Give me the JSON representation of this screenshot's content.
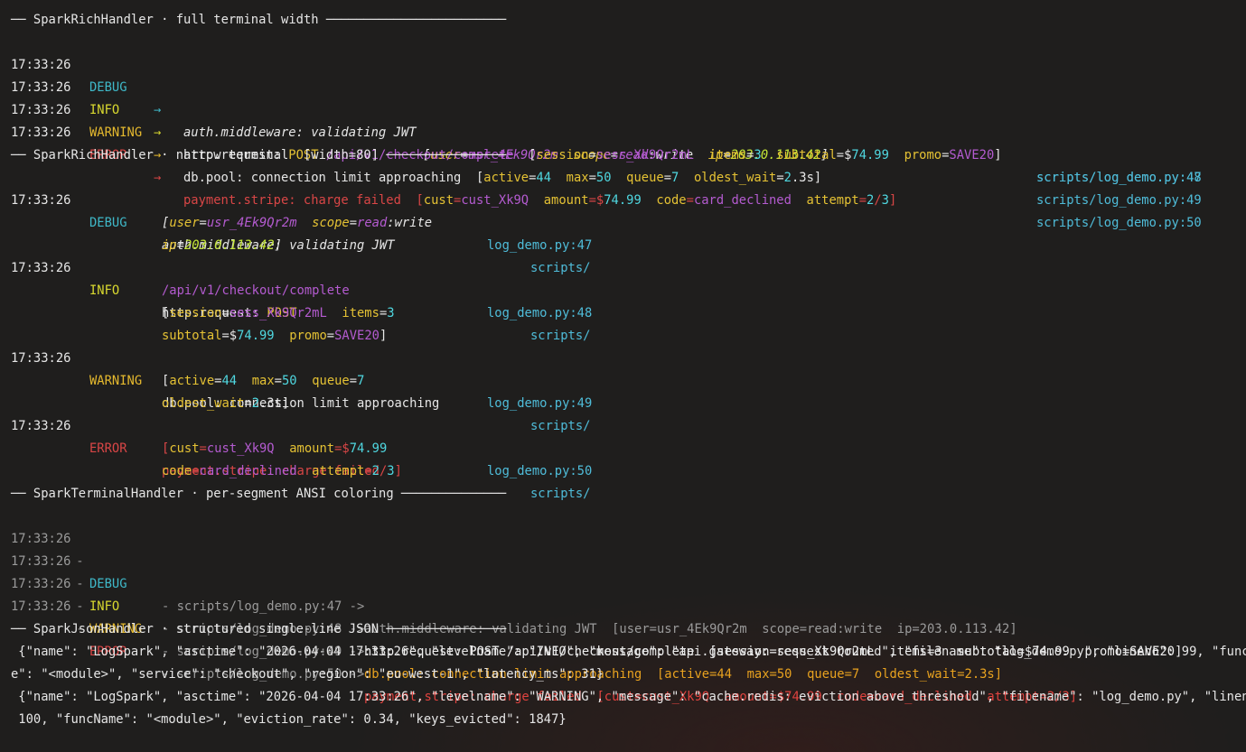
{
  "sections": {
    "full": "── SparkRichHandler · full terminal width ────────────────────────",
    "narrow": "── SparkRichHandler · narrow terminal  [width=80] ────────────────",
    "ansi": "── SparkTerminalHandler · per-segment ANSI coloring ──────────────",
    "json": "── SparkJsonHandler · structured single-line JSON ────────────────"
  },
  "time": "17:33:26",
  "levels": {
    "debug": "DEBUG",
    "info": "INFO",
    "warning": "WARNING",
    "error": "ERROR"
  },
  "arrow": "→",
  "full_rows": {
    "debug": {
      "msg": "auth.middleware: validating JWT",
      "loc": "scripts/log_demo.py:47",
      "ctx": [
        "[",
        "user",
        "=",
        "usr_4Ek9Qr2m",
        "  ",
        "scope",
        "=",
        "read",
        ":write",
        "  ",
        "ip",
        "=",
        "203.",
        "0.113.42",
        "]"
      ]
    },
    "info": {
      "loc": "scripts/log_demo.py:48",
      "logger": "http.request: ",
      "method": "POST ",
      "route": "/api/v1/checkout/complete",
      "ctx": [
        "  [",
        "session",
        "=",
        "sess_Xk9Qr2mL",
        "  ",
        "items",
        "=",
        "3",
        "  ",
        "subtotal",
        "=$",
        "74.99",
        "  ",
        "promo",
        "=",
        "SAVE20",
        "]"
      ]
    },
    "warning": {
      "loc": "scripts/log_demo.py:49",
      "logger": "db.pool: connection limit approaching",
      "ctx": [
        "  [",
        "active",
        "=",
        "44",
        "  ",
        "max",
        "=",
        "50",
        "  ",
        "queue",
        "=",
        "7",
        "  ",
        "oldest_wait",
        "=",
        "2",
        ".3s]"
      ]
    },
    "error": {
      "loc": "scripts/log_demo.py:50",
      "msg": "payment.stripe: charge failed",
      "ctx": [
        "  [",
        "cust",
        "=",
        "cust_Xk9Q",
        "  ",
        "amount",
        "=$",
        "74.99",
        "  ",
        "code",
        "=",
        "card_declined",
        "  ",
        "attempt",
        "=",
        "2",
        "/",
        "3",
        "]"
      ]
    }
  },
  "narrow_rows": {
    "loc_a": "scripts/",
    "debug": {
      "l1": "auth.middleware: validating JWT",
      "l2": [
        "[",
        "user",
        "=",
        "usr_4Ek9Qr2m",
        "  ",
        "scope",
        "=",
        "read",
        ":write"
      ],
      "l3": [
        "ip",
        "=",
        "203.",
        "0.113.42",
        "]"
      ],
      "loc_b": "log_demo.py:47"
    },
    "info": {
      "l1a": "http.request: ",
      "l1b": "POST",
      "l2": "/api/v1/checkout/complete",
      "l3": [
        "[",
        "session",
        "=",
        "sess_Xk9Qr2mL",
        "  ",
        "items",
        "=",
        "3"
      ],
      "l4": [
        "subtotal",
        "=$",
        "74.99",
        "  ",
        "promo",
        "=",
        "SAVE20",
        "]"
      ],
      "loc_b": "log_demo.py:48"
    },
    "warning": {
      "l1": "db.pool: connection limit approaching",
      "l2": [
        "[",
        "active",
        "=",
        "44",
        "  ",
        "max",
        "=",
        "50",
        "  ",
        "queue",
        "=",
        "7"
      ],
      "l3": [
        "oldest_wait",
        "=",
        "2",
        ".3s]"
      ],
      "loc_b": "log_demo.py:49"
    },
    "error": {
      "l1": "payment.stripe: charge failed",
      "l2": [
        "[",
        "cust",
        "=",
        "cust_Xk9Q",
        "  ",
        "amount",
        "=$",
        "74.99"
      ],
      "l3": [
        "code",
        "=",
        "card_declined",
        "  ",
        "attempt",
        "=",
        "2",
        "/",
        "3",
        "]"
      ],
      "loc_b": "log_demo.py:50"
    }
  },
  "ansi_rows": {
    "sep": " - ",
    "debug": {
      "loc": "- scripts/log_demo.py:47 -> ",
      "msg": "auth.middleware: validating JWT  [user=usr_4Ek9Qr2m  scope=read:write  ip=203.0.113.42]"
    },
    "info": {
      "loc": "- scripts/log_demo.py:48 -> ",
      "msg": "http.request: POST /api/v1/checkout/complete  [session=sess_Xk9Qr2mL  items=3  subtotal=$74.99  promo=SAVE20]"
    },
    "warning": {
      "loc": "- scripts/log_demo.py:49 -> ",
      "msg": "db.pool: connection limit approaching  [active=44  max=50  queue=7  oldest_wait=2.3s]"
    },
    "error": {
      "loc": "- scripts/log_demo.py:50 -> ",
      "msg": "payment.stripe: charge failed  [cust=cust_Xk9Q  amount=$74.99  code=card_declined  attempt=2/3]"
    }
  },
  "json_lines": [
    " {\"name\": \"LogSpark\", \"asctime\": \"2026-04-04 17:33:26\", \"levelname\": \"INFO\", \"message\": \"api.gateway: request routed\", \"filename\": \"log_demo.py\", \"lineno\": 99, \"funcNam",
    "e\": \"<module>\", \"service\": \"checkout\", \"region\": \"eu-west-1\", \"latency_ms\": 31}",
    " {\"name\": \"LogSpark\", \"asctime\": \"2026-04-04 17:33:26\", \"levelname\": \"WARNING\", \"message\": \"cache.redis: eviction above threshold\", \"filename\": \"log_demo.py\", \"lineno\":",
    " 100, \"funcName\": \"<module>\", \"eviction_rate\": 0.34, \"keys_evicted\": 1847}"
  ],
  "colors": {
    "background": "#1f1e1d",
    "debug": "#3fb8c8",
    "info": "#d8d82f",
    "warning": "#e5b92e",
    "error": "#d94646",
    "path": "#4fbcd9"
  }
}
